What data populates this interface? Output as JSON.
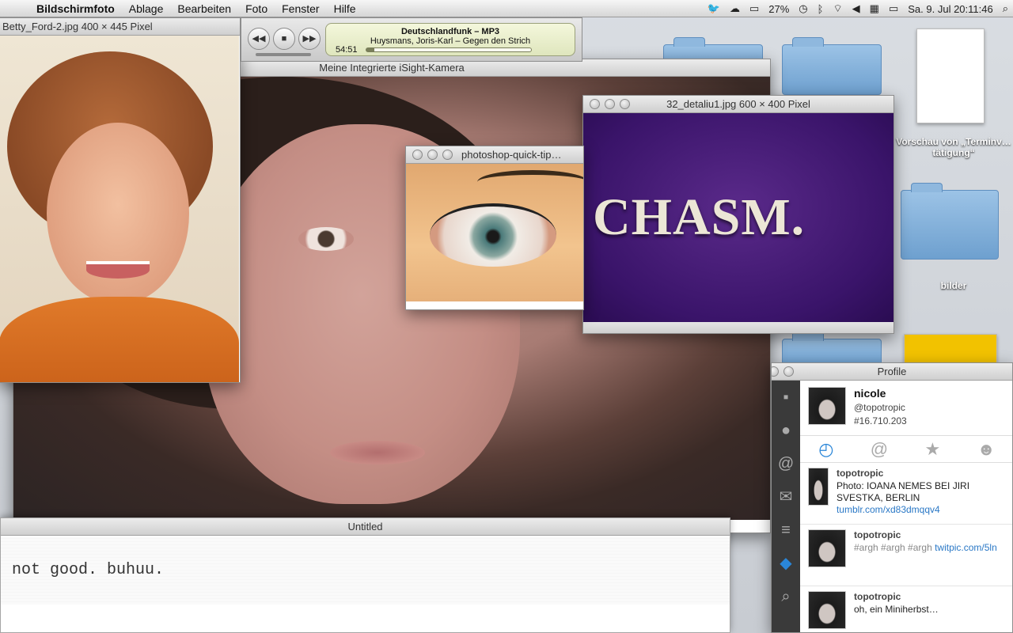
{
  "menubar": {
    "app_name": "Bildschirmfoto",
    "menus": [
      "Ablage",
      "Bearbeiten",
      "Foto",
      "Fenster",
      "Hilfe"
    ],
    "battery": "27%",
    "clock": "Sa. 9. Jul  20:11:46"
  },
  "desktop": {
    "items": [
      {
        "label": "Vorschau von „Terminv…tätigung“",
        "icon": "document-icon"
      },
      {
        "label": "bilder",
        "icon": "folder-icon"
      }
    ]
  },
  "windows": {
    "betty": {
      "title": "Betty_Ford-2.jpg 400 × 445 Pixel"
    },
    "camera": {
      "title": "Meine Integrierte iSight-Kamera"
    },
    "eye": {
      "title": "photoshop-quick-tip…"
    },
    "chasm": {
      "title": "32_detaliu1.jpg 600 × 400 Pixel",
      "image_text": "CHASM."
    },
    "editor": {
      "title": "Untitled",
      "text": "not good. buhuu."
    }
  },
  "itunes": {
    "station": "Deutschlandfunk – MP3",
    "track": "Huysmans, Joris-Karl – Gegen den Strich",
    "elapsed": "54:51",
    "progress": 0.05
  },
  "twitter": {
    "window_title": "Profile",
    "profile": {
      "name": "nicole",
      "handle": "@topotropic",
      "tweet_count": "#16.710.203"
    },
    "tabs": [
      "timeline-icon",
      "mentions-icon",
      "favorites-icon",
      "user-icon"
    ],
    "tweets": [
      {
        "user": "topotropic",
        "text": "Photo: IOANA NEMES BEI JIRI SVESTKA, BERLIN ",
        "link": "tumblr.com/xd83dmqqv4"
      },
      {
        "user": "topotropic",
        "text": "#argh #argh #argh ",
        "link": "twitpic.com/5ln"
      },
      {
        "user": "topotropic",
        "text": "oh, ein Miniherbst…",
        "link": ""
      }
    ]
  },
  "colors": {
    "accent": "#2a86d8",
    "purple": "#3a146a",
    "sweater": "#e07a2a"
  }
}
